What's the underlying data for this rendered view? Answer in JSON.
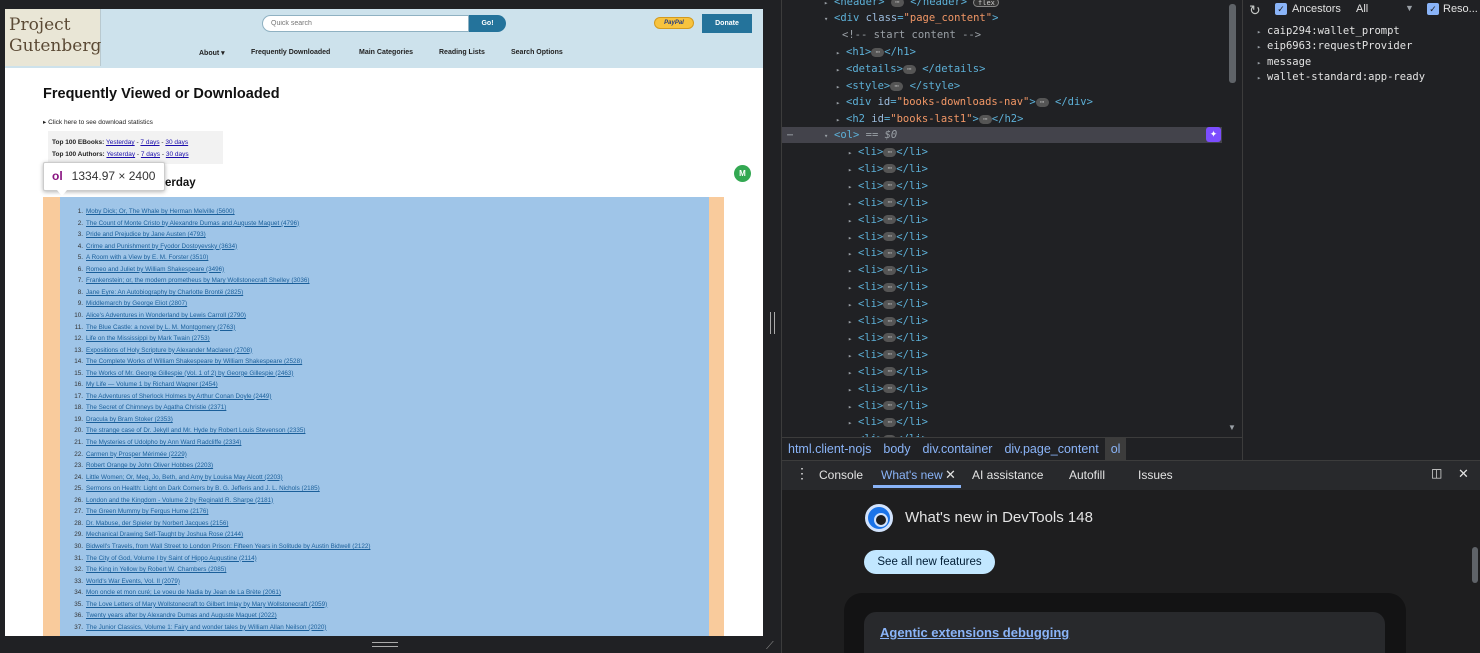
{
  "site": {
    "logo_line1": "Project",
    "logo_line2": "Gutenberg",
    "search_placeholder": "Quick search",
    "go_label": "Go!",
    "paypal_label": "PayPal",
    "donate_label": "Donate",
    "nav": [
      "About ▾",
      "Frequently Downloaded",
      "Main Categories",
      "Reading Lists",
      "Search Options"
    ],
    "page_title": "Frequently Viewed or Downloaded",
    "stats_link": "▸ Click here to see download statistics",
    "top100": {
      "ebooks_label": "Top 100 EBooks:",
      "authors_label": "Top 100 Authors:",
      "links": [
        "Yesterday",
        "7 days",
        "30 days"
      ],
      "sep": " - "
    },
    "section_heading_fragment": "erday",
    "tooltip": {
      "tag": "ol",
      "dims": "1334.97 × 2400"
    },
    "ext_badge": "M"
  },
  "books": [
    "Moby Dick; Or, The Whale by Herman Melville (5600)",
    "The Count of Monte Cristo by Alexandre Dumas and Auguste Maquet (4796)",
    "Pride and Prejudice by Jane Austen (4793)",
    "Crime and Punishment by Fyodor Dostoyevsky (3634)",
    "A Room with a View by E. M. Forster (3510)",
    "Romeo and Juliet by William Shakespeare (3496)",
    "Frankenstein; or, the modern prometheus by Mary Wollstonecraft Shelley (3036)",
    "Jane Eyre: An Autobiography by Charlotte Brontë (2825)",
    "Middlemarch by George Eliot (2807)",
    "Alice's Adventures in Wonderland by Lewis Carroll (2790)",
    "The Blue Castle: a novel by L. M. Montgomery (2763)",
    "Life on the Mississippi by Mark Twain (2753)",
    "Expositions of Holy Scripture by Alexander Maclaren (2708)",
    "The Complete Works of William Shakespeare by William Shakespeare (2528)",
    "The Works of Mr. George Gillespie (Vol. 1 of 2) by George Gillespie (2463)",
    "My Life — Volume 1 by Richard Wagner (2454)",
    "The Adventures of Sherlock Holmes by Arthur Conan Doyle (2449)",
    "The Secret of Chimneys by Agatha Christie (2371)",
    "Dracula by Bram Stoker (2353)",
    "The strange case of Dr. Jekyll and Mr. Hyde by Robert Louis Stevenson (2335)",
    "The Mysteries of Udolpho by Ann Ward Radcliffe (2334)",
    "Carmen by Prosper Mérimée (2229)",
    "Robert Orange by John Oliver Hobbes (2203)",
    "Little Women; Or, Meg, Jo, Beth, and Amy by Louisa May Alcott (2203)",
    "Sermons on Health: Light on Dark Corners by B. G. Jefferis and J. L. Nichols (2185)",
    "London and the Kingdom - Volume 2 by Reginald R. Sharpe (2181)",
    "The Green Mummy by Fergus Hume (2176)",
    "Dr. Mabuse, der Spieler by Norbert Jacques (2156)",
    "Mechanical Drawing Self-Taught by Joshua Rose (2144)",
    "Bidwell's Travels, from Wall Street to London Prison: Fifteen Years in Solitude by Austin Bidwell (2122)",
    "The City of God, Volume I by Saint of Hippo Augustine (2114)",
    "The King in Yellow by Robert W. Chambers (2085)",
    "World's War Events, Vol. II (2079)",
    "Mon oncle et mon curé; Le voeu de Nadia by Jean de La Brète (2061)",
    "The Love Letters of Mary Wollstonecraft to Gilbert Imlay by Mary Wollstonecraft (2059)",
    "Twenty years after by Alexandre Dumas and Auguste Maquet (2022)",
    "The Junior Classics, Volume 1: Fairy and wonder tales by William Allan Neilson (2020)"
  ],
  "devtools": {
    "elements": [
      {
        "indent": 0,
        "tri": "▸",
        "html": "header-close"
      },
      {
        "indent": 1,
        "tri": "▾",
        "open": "div",
        "attr": "class",
        "val": "\"page_content\""
      },
      {
        "indent": 2,
        "comment": "<!-- start content -->"
      },
      {
        "indent": 2,
        "tri": "▸",
        "tag": "h1"
      },
      {
        "indent": 2,
        "tri": "▸",
        "tag": "details"
      },
      {
        "indent": 2,
        "tri": "▸",
        "tag": "style"
      },
      {
        "indent": 2,
        "tri": "▸",
        "tag": "div",
        "attr": "id",
        "val": "\"books-downloads-nav\""
      },
      {
        "indent": 2,
        "tri": "▸",
        "tag": "h2",
        "attr": "id",
        "val": "\"books-last1\""
      }
    ],
    "header_line": "<header> ⋯ </header>",
    "flex_badge": "flex",
    "div_line": "<div class=\"page_content\">",
    "comment_line": "<!-- start content -->",
    "h1_line": "<h1>",
    "details_line": "<details>",
    "style_line": "<style>",
    "nav_line_attr": "books-downloads-nav",
    "h2_line_attr": "books-last1",
    "ol_sel": "== $0",
    "li_count": 17,
    "breadcrumbs": [
      "html.client-nojs",
      "body",
      "div.container",
      "div.page_content",
      "ol"
    ],
    "ancestors_label": "Ancestors",
    "all_label": "All",
    "reso_label": "Reso...",
    "props": [
      "caip294:wallet_prompt",
      "eip6963:requestProvider",
      "message",
      "wallet-standard:app-ready"
    ],
    "tabs": [
      "Console",
      "What's new",
      "AI assistance",
      "Autofill",
      "Issues"
    ],
    "whats_new_title": "What's new in DevTools 148",
    "see_all": "See all new features",
    "card_link": "Agentic extensions debugging"
  }
}
